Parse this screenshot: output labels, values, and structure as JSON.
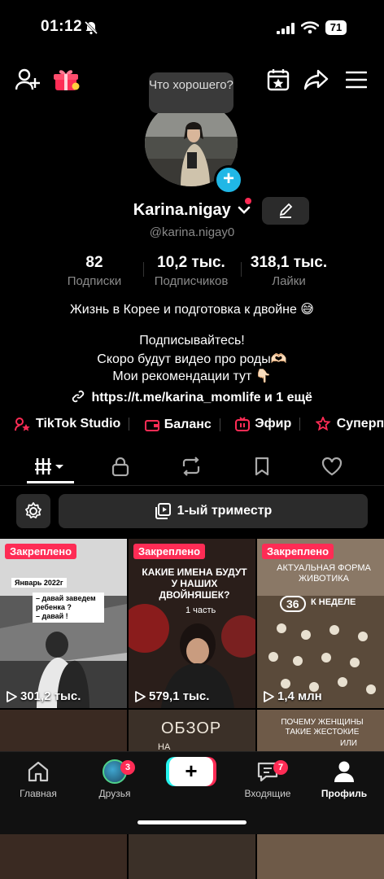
{
  "status": {
    "time": "01:12",
    "battery": "71"
  },
  "profile": {
    "bubble_text": "Что хорошего?",
    "name": "Karina.nigay",
    "handle": "@karina.nigay0",
    "stats": [
      {
        "value": "82",
        "label": "Подписки"
      },
      {
        "value": "10,2 тыс.",
        "label": "Подписчиков"
      },
      {
        "value": "318,1 тыс.",
        "label": "Лайки"
      }
    ],
    "bio_line1": "Жизнь в Корее и подготовка к двойне 😅",
    "bio_line2": "Подписывайтесь!",
    "bio_line3": "Скоро будут видео про роды🫶🏻",
    "bio_line4": "Мои рекомендации тут 👇🏻",
    "link": "https://t.me/karina_momlife",
    "link_more": "и 1 ещё"
  },
  "tools": [
    {
      "label": "TikTok Studio"
    },
    {
      "label": "Баланс"
    },
    {
      "label": "Эфир"
    },
    {
      "label": "Суперпод"
    }
  ],
  "playlist_label": "1-ый триместр",
  "videos": [
    {
      "pinned": "Закреплено",
      "views": "301,2 тыс.",
      "overlay": "Январь 2022г",
      "overlay2": "– давай заведем ребенка ?",
      "overlay3": "– давай !"
    },
    {
      "pinned": "Закреплено",
      "views": "579,1 тыс.",
      "overlay": "КАКИЕ ИМЕНА БУДУТ У НАШИХ ДВОЙНЯШЕК?",
      "overlay2": "1 часть"
    },
    {
      "pinned": "Закреплено",
      "views": "1,4 млн",
      "overlay": "АКТУАЛЬНАЯ ФОРМА ЖИВОТИКА",
      "overlay2": "36",
      "overlay3": "К НЕДЕЛЕ"
    },
    {
      "overlay": ""
    },
    {
      "overlay": "ОБЗОР",
      "overlay2": "НА"
    },
    {
      "overlay": "ПОЧЕМУ ЖЕНЩИНЫ ТАКИЕ ЖЕСТОКИЕ",
      "overlay2": "ИЛИ"
    }
  ],
  "nav": {
    "home": "Главная",
    "friends": "Друзья",
    "friends_badge": "3",
    "inbox": "Входящие",
    "inbox_badge": "7",
    "profile": "Профиль",
    "create": "+"
  },
  "colors": {
    "accent": "#fe2c55",
    "cyan": "#25f4ee",
    "verify_blue": "#20b7e6"
  }
}
